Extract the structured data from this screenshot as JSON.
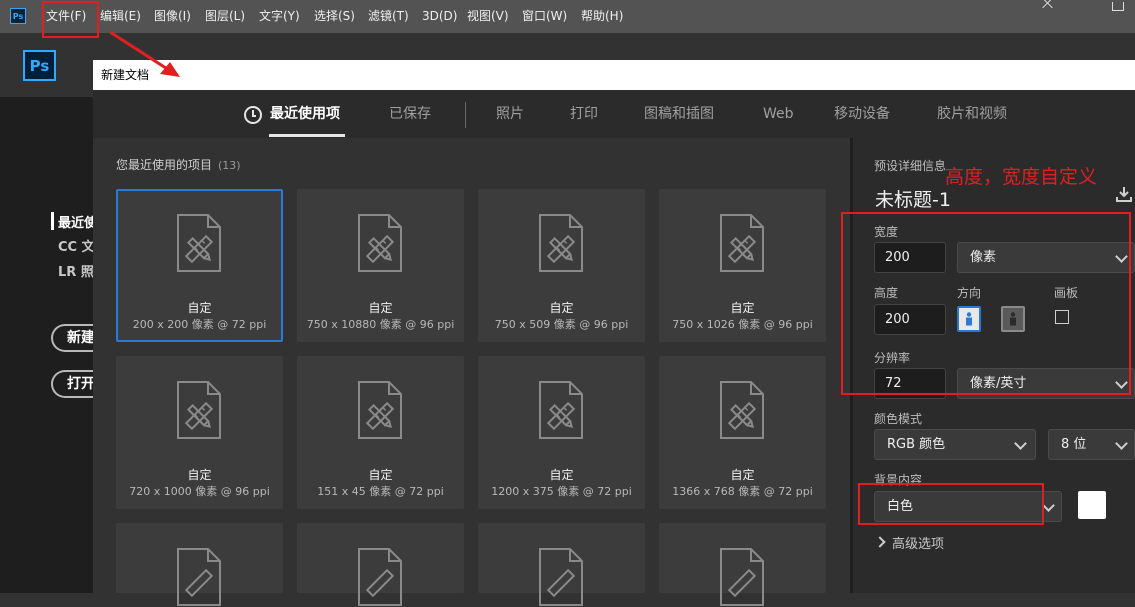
{
  "menubar": {
    "app_icon": "Ps",
    "items": [
      "文件(F)",
      "编辑(E)",
      "图像(I)",
      "图层(L)",
      "文字(Y)",
      "选择(S)",
      "滤镜(T)",
      "3D(D)",
      "视图(V)",
      "窗口(W)",
      "帮助(H)"
    ]
  },
  "left_panel": {
    "logo": "Ps",
    "nav_items": [
      "最近使",
      "CC 文",
      "LR 照"
    ],
    "buttons": [
      "新建",
      "打开"
    ]
  },
  "dialog": {
    "title": "新建文档",
    "tabs": [
      "最近使用项",
      "已保存",
      "照片",
      "打印",
      "图稿和插图",
      "Web",
      "移动设备",
      "胶片和视频"
    ],
    "active_tab_index": 0
  },
  "recent": {
    "title": "您最近使用的项目",
    "count": "(13)",
    "items": [
      {
        "name": "自定",
        "dims": "200 x 200 像素 @ 72 ppi",
        "selected": true
      },
      {
        "name": "自定",
        "dims": "750 x 10880 像素 @ 96 ppi"
      },
      {
        "name": "自定",
        "dims": "750 x 509 像素 @ 96 ppi"
      },
      {
        "name": "自定",
        "dims": "750 x 1026 像素 @ 96 ppi"
      },
      {
        "name": "自定",
        "dims": "720 x 1000 像素 @ 96 ppi"
      },
      {
        "name": "自定",
        "dims": "151 x 45 像素 @ 72 ppi"
      },
      {
        "name": "自定",
        "dims": "1200 x 375 像素 @ 72 ppi"
      },
      {
        "name": "自定",
        "dims": "1366 x 768 像素 @ 72 ppi"
      }
    ]
  },
  "preset_details": {
    "section_label": "预设详细信息",
    "doc_title": "未标题-1",
    "width_label": "宽度",
    "width_value": "200",
    "width_unit": "像素",
    "height_label": "高度",
    "height_value": "200",
    "orientation_label": "方向",
    "artboard_label": "画板",
    "resolution_label": "分辨率",
    "resolution_value": "72",
    "resolution_unit": "像素/英寸",
    "color_mode_label": "颜色模式",
    "color_mode_value": "RGB 颜色",
    "bit_depth_value": "8 位",
    "background_label": "背景内容",
    "background_value": "白色",
    "background_swatch_color": "#ffffff",
    "advanced_label": "高级选项"
  },
  "annotation": {
    "text": "高度，宽度自定义",
    "color": "#e02020"
  },
  "colors": {
    "accent": "#2a79d8",
    "ps_blue": "#31a8ff"
  }
}
